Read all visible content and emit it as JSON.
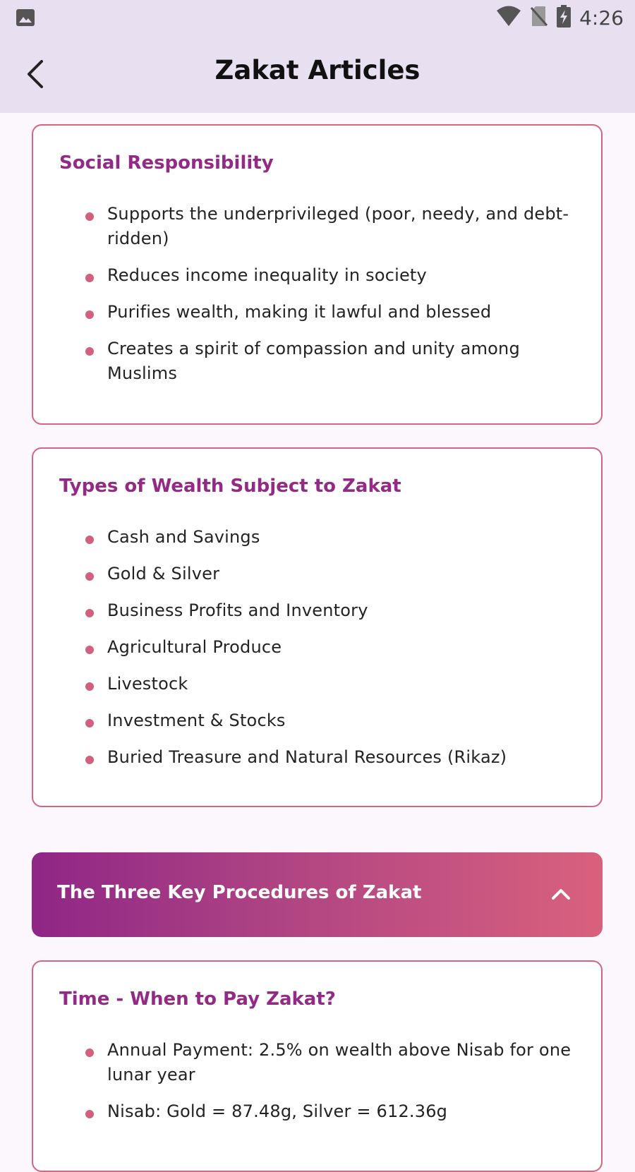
{
  "status_bar": {
    "time": "4:26",
    "icons": [
      "photo-icon",
      "wifi-icon",
      "no-sim-icon",
      "battery-charging-icon"
    ]
  },
  "app_bar": {
    "title": "Zakat Articles",
    "back_icon": "back-arrow-icon"
  },
  "sections": [
    {
      "title": "Social Responsibility",
      "items": [
        "Supports the underprivileged (poor, needy, and debt-ridden)",
        "Reduces income inequality in society",
        "Purifies wealth, making it lawful and blessed",
        "Creates a spirit of compassion and unity among Muslims"
      ]
    },
    {
      "title": "Types of Wealth Subject to Zakat",
      "items": [
        "Cash and Savings",
        "Gold & Silver",
        "Business Profits and Inventory",
        "Agricultural Produce",
        "Livestock",
        "Investment & Stocks",
        "Buried Treasure and Natural Resources (Rikaz)"
      ]
    }
  ],
  "procedures": {
    "label": "The Three Key Procedures of Zakat",
    "chevron_icon": "chevron-up-icon",
    "expanded": true
  },
  "time_section": {
    "title": "Time - When to Pay Zakat?",
    "items": [
      "Annual Payment: 2.5% on wealth above Nisab for one lunar year",
      "Nisab: Gold = 87.48g, Silver = 612.36g"
    ]
  },
  "colors": {
    "accent_purple": "#922a86",
    "accent_pink": "#d46682",
    "app_bar_bg": "#e8e0f0",
    "page_bg": "#fcf6fd"
  }
}
